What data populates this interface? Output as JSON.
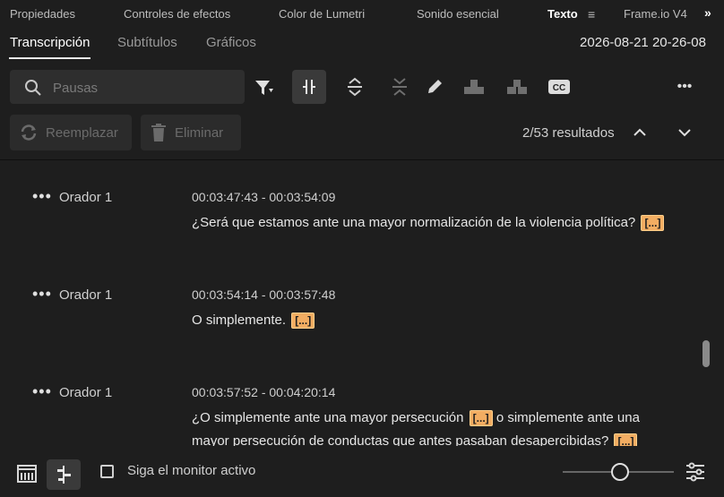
{
  "panel_tabs": [
    "Propiedades",
    "Controles de efectos",
    "Color de Lumetri",
    "Sonido esencial",
    "Texto",
    "Frame.io V4"
  ],
  "panel_menu_glyph": "≡",
  "more_panels_glyph": "»",
  "subtabs": [
    "Transcripción",
    "Subtítulos",
    "Gráficos"
  ],
  "timestamp": "2026-08-21 20-26-08",
  "search": {
    "placeholder": "Pausas",
    "value": ""
  },
  "actions": {
    "replace": "Reemplazar",
    "delete": "Eliminar"
  },
  "results_text": "2/53 resultados",
  "more_glyph": "•••",
  "pause_marker": "[...]",
  "entries": [
    {
      "speaker": "Orador 1",
      "time": "00:03:47:43 - 00:03:54:09",
      "text": "¿Será que estamos ante una mayor normalización de la violencia política?"
    },
    {
      "speaker": "Orador 1",
      "time": "00:03:54:14 - 00:03:57:48",
      "text": "O simplemente."
    },
    {
      "speaker": "Orador 1",
      "time": "00:03:57:52 - 00:04:20:14",
      "text_a": "¿O simplemente ante una mayor persecución",
      "text_b": "o simplemente ante una mayor persecución de conductas que antes pasaban desapercibidas?"
    }
  ],
  "follow_monitor_label": "Siga el monitor activo",
  "accent_color": "#f2ad62"
}
